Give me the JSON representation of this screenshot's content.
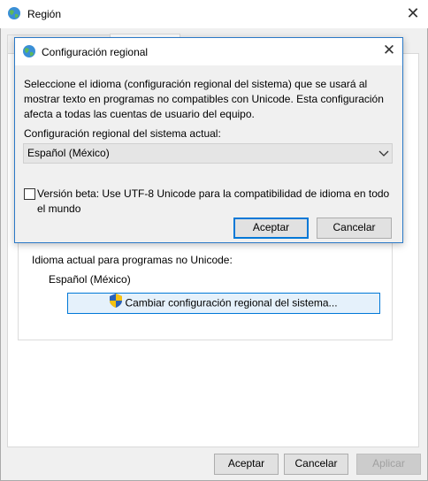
{
  "outer_window": {
    "title": "Región",
    "close_glyph": "✕",
    "accept_label": "Aceptar",
    "cancel_label": "Cancelar",
    "apply_label": "Aplicar"
  },
  "unicode_section": {
    "label": "Idioma actual para programas no Unicode:",
    "value": "Español (México)",
    "change_button_label": "Cambiar configuración regional del sistema..."
  },
  "dialog": {
    "title": "Configuración regional",
    "close_glyph": "✕",
    "description": "Seleccione el idioma (configuración regional del sistema) que se usará al mostrar texto en programas no compatibles con Unicode. Esta configuración afecta a todas las cuentas de usuario del equipo.",
    "current_locale_label": "Configuración regional del sistema actual:",
    "selected_locale": "Español (México)",
    "beta_checkbox_label": "Versión beta: Use UTF-8 Unicode para la compatibilidad de idioma en todo el mundo",
    "beta_checked": false,
    "accept_label": "Aceptar",
    "cancel_label": "Cancelar"
  },
  "icons": {
    "window_icon": "globe-icon",
    "uac": "shield-icon",
    "dropdown": "chevron-down-icon"
  },
  "colors": {
    "accent": "#0078d7",
    "button_face": "#e1e1e1",
    "highlight_button": "#e5f1fb"
  }
}
